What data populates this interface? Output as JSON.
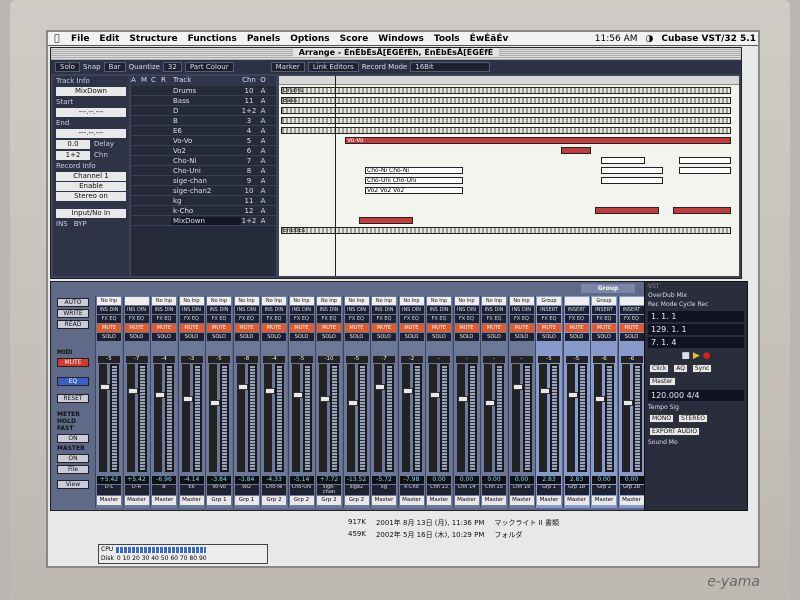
{
  "menubar": {
    "items": [
      "File",
      "Edit",
      "Structure",
      "Functions",
      "Panels",
      "Options",
      "Score",
      "Windows",
      "Tools",
      "ÉwÉãÉv"
    ],
    "clock": "11:56 AM",
    "app": "Cubase VST/32 5.1"
  },
  "arrange": {
    "title": "Arrange - ÉnÉbÉsÅ[ÉGÉfÉh, ÉnÉbÉsÅ[ÉGÉfÉ",
    "toolbar": {
      "solo": "Solo",
      "snap_label": "Snap",
      "snap_value": "Bar",
      "quantize_label": "Quantize",
      "quantize_value": "32",
      "part_colour": "Part Colour",
      "marker": "Marker",
      "link_editors": "Link Editors",
      "record_mode_label": "Record Mode",
      "record_mode_value": "16Bit"
    },
    "inspector": {
      "track_info": "Track Info",
      "track_name": "MixDown",
      "start": "Start",
      "start_value": "---.--.---",
      "end": "End",
      "end_value": "---.--.---",
      "delay": "Delay",
      "delay_value": "0.0",
      "chn": "Chn",
      "chn_value": "1+2",
      "record_info": "Record Info",
      "channel": "Channel 1",
      "enable": "Enable",
      "stereo": "Stereo on",
      "input": "Input/No In",
      "ins": "INS",
      "byp": "BYP"
    },
    "track_header": {
      "a": "A",
      "m": "M",
      "c": "C",
      "r": "R",
      "track": "Track",
      "chn": "Chn",
      "o": "O"
    },
    "tracks": [
      {
        "name": "Drums",
        "chn": "10",
        "o": "A"
      },
      {
        "name": "Bass",
        "chn": "11",
        "o": "A"
      },
      {
        "name": "D",
        "chn": "1+2",
        "o": "A"
      },
      {
        "name": "B",
        "chn": "3",
        "o": "A"
      },
      {
        "name": "E6",
        "chn": "4",
        "o": "A"
      },
      {
        "name": "Vo-Vo",
        "chn": "5",
        "o": "A"
      },
      {
        "name": "Vo2",
        "chn": "6",
        "o": "A"
      },
      {
        "name": "Cho-Ni",
        "chn": "7",
        "o": "A"
      },
      {
        "name": "Cho-Uni",
        "chn": "8",
        "o": "A"
      },
      {
        "name": "sige-chan",
        "chn": "9",
        "o": "A"
      },
      {
        "name": "sige-chan2",
        "chn": "10",
        "o": "A"
      },
      {
        "name": "kg",
        "chn": "11",
        "o": "A"
      },
      {
        "name": "k-Cho",
        "chn": "12",
        "o": "A"
      },
      {
        "name": "MixDown",
        "chn": "1+2",
        "o": "A"
      }
    ],
    "part_labels": {
      "drums": "Drums",
      "bass": "Bass",
      "vo": "Vo-Vo",
      "vo2": "Vo2 Vo2",
      "cho_ni": "Cho-Ni Cho-Ni",
      "cho_uni": "Cho-Uni Cho-Uni",
      "vo2b": "Vo2 Vo2 Vo2",
      "mixdown": "ÉnÉbÉs"
    }
  },
  "mixer": {
    "left_buttons": [
      "AUTO",
      "WRITE",
      "READ",
      "MIDI",
      "MUTE",
      "EQ",
      "RESET",
      "METER",
      "MASTER",
      "File",
      "View"
    ],
    "meter_opts": [
      "HOLD",
      "FAST",
      "ON",
      "ON"
    ],
    "strips": [
      {
        "top": "No Inp",
        "val_top": "-5",
        "val": "+5.42",
        "name": "D-L",
        "route": "Master"
      },
      {
        "top": "",
        "val_top": "-7",
        "val": "+5.42",
        "name": "D-R",
        "route": "Master"
      },
      {
        "top": "No Inp",
        "val_top": "-4",
        "val": "-6.96",
        "name": "B",
        "route": "Master"
      },
      {
        "top": "No Inp",
        "val_top": "-3",
        "val": "-4.14",
        "name": "E6",
        "route": "Master"
      },
      {
        "top": "No Inp",
        "val_top": "-5",
        "val": "-3.84",
        "name": "Vo-Vo",
        "route": "Grp 1"
      },
      {
        "top": "No Inp",
        "val_top": "-8",
        "val": "-3.84",
        "name": "Vo2",
        "route": "Grp 1"
      },
      {
        "top": "No Inp",
        "val_top": "-4",
        "val": "-4.33",
        "name": "Cho-Ni",
        "route": "Grp 2"
      },
      {
        "top": "No Inp",
        "val_top": "-5",
        "val": "-5.14",
        "name": "Cho-Uni",
        "route": "Grp 2"
      },
      {
        "top": "No Inp",
        "val_top": "-10",
        "val": "+7.72",
        "name": "sige-chan",
        "route": "Grp 2"
      },
      {
        "top": "No Inp",
        "val_top": "-5",
        "val": "-13.52",
        "name": "sige2",
        "route": "Grp 2"
      },
      {
        "top": "No Inp",
        "val_top": "-7",
        "val": "-5.72",
        "name": "kg",
        "route": "Master"
      },
      {
        "top": "No Inp",
        "val_top": "-2",
        "val": "-7.98",
        "name": "k-Cho",
        "route": "Master"
      },
      {
        "top": "No Inp",
        "val_top": "-",
        "val": "0.00",
        "name": "Chn 13",
        "route": "Master"
      },
      {
        "top": "No Inp",
        "val_top": "-",
        "val": "0.00",
        "name": "Chn 14",
        "route": "Master"
      },
      {
        "top": "No Inp",
        "val_top": "-",
        "val": "0.00",
        "name": "Chn 15",
        "route": "Master"
      },
      {
        "top": "No Inp",
        "val_top": "-",
        "val": "0.00",
        "name": "Chn 16",
        "route": "Master"
      },
      {
        "top": "Group",
        "val_top": "-5",
        "val": "2.83",
        "name": "Grp 1",
        "route": "Master"
      },
      {
        "top": "",
        "val_top": "-5",
        "val": "2.83",
        "name": "Grp 1b",
        "route": "Master"
      },
      {
        "top": "Group",
        "val_top": "-6",
        "val": "0.00",
        "name": "Grp 2",
        "route": "Master"
      },
      {
        "top": "",
        "val_top": "-6",
        "val": "0.00",
        "name": "Grp 2b",
        "route": "Master"
      }
    ],
    "strip_buttons": {
      "ins": "INS DIN",
      "fx": "FX EQ",
      "mute": "MUTE",
      "solo": "SOLO",
      "insert": "INSERT"
    }
  },
  "transport": {
    "title": "VST",
    "row1": "OverDub  Mix",
    "row2": "Rec Mode  Cycle Rec",
    "pos1": "1. 1. 1",
    "pos2": "129. 1. 1",
    "pos3": "7. 1. 4",
    "tempo": "120.000",
    "sig": "4/4",
    "tempo_label": "Tempo",
    "sig_label": "Sig",
    "click": "Click",
    "master": "Master",
    "sync": "Sync",
    "auto": "AQ",
    "mono": "MONO",
    "stereo": "STEREO",
    "export": "EXPORT AUDIO",
    "sound_mo": "Sound Mo"
  },
  "desktop": {
    "files": [
      {
        "size": "917K",
        "date": "2001年 8月 13日 (月), 11:36 PM",
        "kind": "マックライト II 書類"
      },
      {
        "size": "459K",
        "date": "2002年 5月 16日 (木), 10:29 PM",
        "kind": "フォルダ"
      }
    ],
    "meter_labels": {
      "cpu": "CPU",
      "disk": "Disk"
    },
    "meter_scale": "0 10 20 30 40 50 60 70 80 90"
  },
  "bezel_brand": "e-yama"
}
